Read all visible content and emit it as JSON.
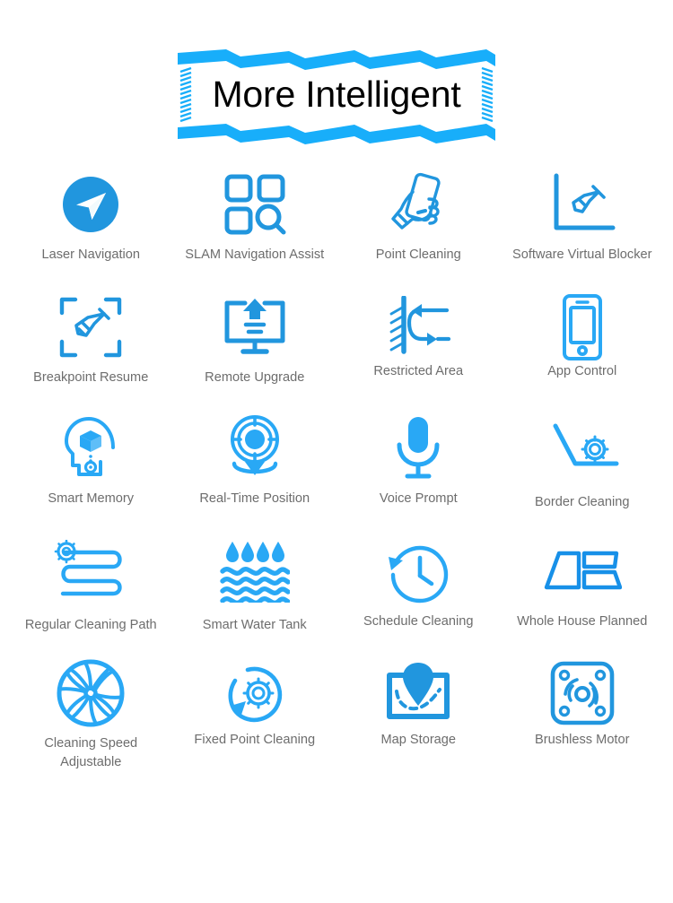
{
  "banner": {
    "title": "More Intelligent",
    "ribbon_color": "#18AEFA",
    "title_color": "#000000"
  },
  "theme": {
    "icon_blue": "#2196DE",
    "icon_blue_light": "#29A8F5",
    "label_color": "#6d6d6d",
    "background": "#ffffff"
  },
  "features": {
    "rows": [
      [
        {
          "label": "Laser Navigation",
          "icon": "laser-navigation-icon"
        },
        {
          "label": "SLAM Navigation Assist",
          "icon": "slam-navigation-assist-icon"
        },
        {
          "label": "Point Cleaning",
          "icon": "point-cleaning-icon"
        },
        {
          "label": "Software Virtual Blocker",
          "icon": "software-virtual-blocker-icon"
        }
      ],
      [
        {
          "label": "Breakpoint Resume",
          "icon": "breakpoint-resume-icon"
        },
        {
          "label": "Remote Upgrade",
          "icon": "remote-upgrade-icon"
        },
        {
          "label": "Restricted Area",
          "icon": "restricted-area-icon"
        },
        {
          "label": "App Control",
          "icon": "app-control-icon"
        }
      ],
      [
        {
          "label": "Smart Memory",
          "icon": "smart-memory-icon"
        },
        {
          "label": "Real-Time Position",
          "icon": "real-time-position-icon"
        },
        {
          "label": "Voice Prompt",
          "icon": "voice-prompt-icon"
        },
        {
          "label": "Border Cleaning",
          "icon": "border-cleaning-icon"
        }
      ],
      [
        {
          "label": "Regular Cleaning Path",
          "icon": "regular-cleaning-path-icon"
        },
        {
          "label": "Smart Water Tank",
          "icon": "smart-water-tank-icon"
        },
        {
          "label": "Schedule Cleaning",
          "icon": "schedule-cleaning-icon"
        },
        {
          "label": "Whole House Planned",
          "icon": "whole-house-planned-icon"
        }
      ],
      [
        {
          "label": "Cleaning Speed\nAdjustable",
          "icon": "cleaning-speed-adjustable-icon"
        },
        {
          "label": "Fixed Point Cleaning",
          "icon": "fixed-point-cleaning-icon"
        },
        {
          "label": "Map Storage",
          "icon": "map-storage-icon"
        },
        {
          "label": "Brushless Motor",
          "icon": "brushless-motor-icon"
        }
      ]
    ]
  }
}
